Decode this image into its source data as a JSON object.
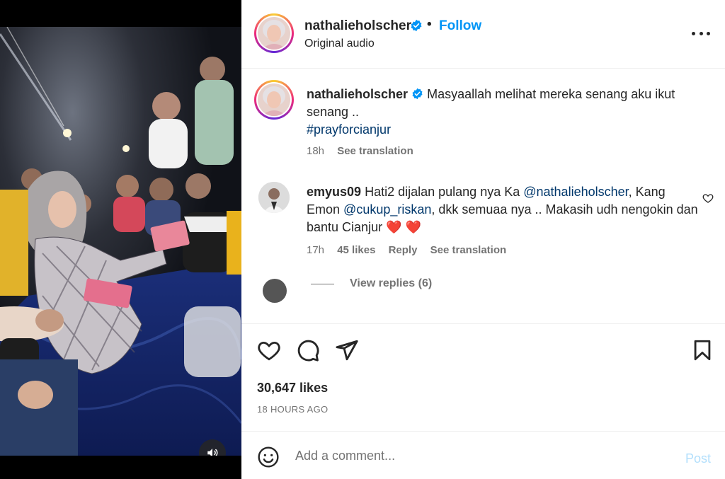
{
  "post": {
    "username": "nathalieholscher",
    "separator": "•",
    "follow_label": "Follow",
    "audio": "Original audio"
  },
  "caption": {
    "username": "nathalieholscher",
    "text": "Masyaallah melihat mereka senang aku ikut senang ..",
    "hashtag": "#prayforcianjur",
    "time": "18h",
    "see_translation": "See translation"
  },
  "comment": {
    "username": "emyus09",
    "text_1": "Hati2 dijalan pulang nya Ka",
    "mention_1": "@nathalieholscher",
    "text_2": ", Kang Emon",
    "mention_2": "@cukup_riskan",
    "text_3": ", dkk semuaa nya .. Makasih udh nengokin dan bantu Cianjur",
    "emoji": "❤️ ❤️",
    "time": "17h",
    "likes": "45 likes",
    "reply": "Reply",
    "see_translation": "See translation",
    "view_replies": "View replies (6)"
  },
  "stats": {
    "likes": "30,647 likes",
    "time": "18 HOURS AGO"
  },
  "composer": {
    "placeholder": "Add a comment...",
    "post_label": "Post"
  },
  "colors": {
    "link": "#0095f6",
    "hashtag": "#00376b",
    "muted": "#737373",
    "verified": "#0095f6",
    "heart_red": "#ed4956"
  },
  "icons": [
    "verified-badge-icon",
    "more-options-icon",
    "heart-icon",
    "comment-icon",
    "share-icon",
    "bookmark-icon",
    "emoji-icon",
    "volume-icon"
  ]
}
